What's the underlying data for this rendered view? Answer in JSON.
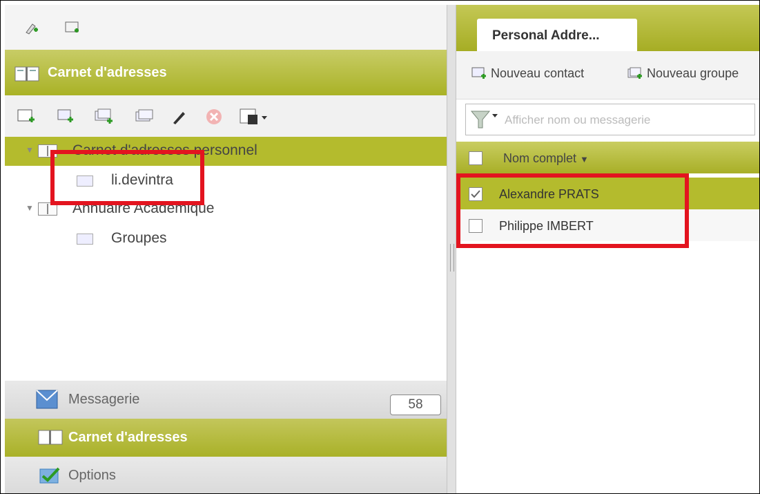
{
  "left": {
    "header_title": "Carnet d'adresses",
    "tree": [
      {
        "label": "Carnet d'adresses personnel",
        "expanded": true,
        "selected": true
      },
      {
        "label": "li.devintra"
      },
      {
        "label": "Annuaire Académique",
        "expanded": true
      },
      {
        "label": "Groupes"
      }
    ],
    "nav": [
      {
        "label": "Messagerie",
        "badge": "58"
      },
      {
        "label": "Carnet d'adresses"
      },
      {
        "label": "Options"
      }
    ]
  },
  "right": {
    "tab_label": "Personal Addre...",
    "toolbar": {
      "new_contact": "Nouveau contact",
      "new_group": "Nouveau groupe"
    },
    "filter_placeholder": "Afficher nom ou messagerie",
    "column_header": "Nom complet",
    "rows": [
      {
        "name": "Alexandre PRATS",
        "checked": true
      },
      {
        "name": "Philippe IMBERT",
        "checked": false
      }
    ]
  },
  "colors": {
    "accent": "#a9b226",
    "selection": "#b4bb2d",
    "highlight_box": "#e3141f"
  }
}
